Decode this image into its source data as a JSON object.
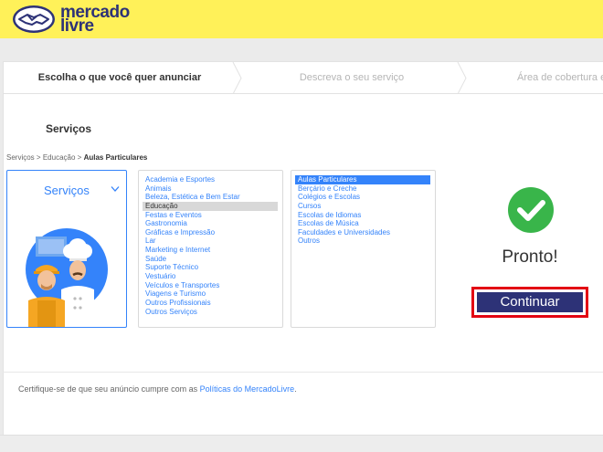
{
  "header": {
    "logo_line1": "mercado",
    "logo_line2": "livre",
    "background": "#fff159"
  },
  "steps": [
    {
      "label": "Escolha o que você quer anunciar",
      "state": "active"
    },
    {
      "label": "Descreva o seu serviço",
      "state": "inactive"
    },
    {
      "label": "Área de cobertura e",
      "state": "inactive"
    }
  ],
  "section_title": "Serviços",
  "breadcrumb": {
    "items": [
      "Serviços",
      "Educação"
    ],
    "separator": ">",
    "current": "Aulas Particulares"
  },
  "category_card": {
    "title": "Serviços",
    "icon": "chevron-down-icon"
  },
  "list1": {
    "items": [
      "Academia e Esportes",
      "Animais",
      "Beleza, Estética e Bem Estar",
      "Educação",
      "Festas e Eventos",
      "Gastronomia",
      "Gráficas e Impressão",
      "Lar",
      "Marketing e Internet",
      "Saúde",
      "Suporte Técnico",
      "Vestuário",
      "Veículos e Transportes",
      "Viagens e Turismo",
      "Outros Profissionais",
      "Outros Serviços"
    ],
    "selected": "Educação"
  },
  "list2": {
    "items": [
      "Aulas Particulares",
      "Berçário e Creche",
      "Colégios e Escolas",
      "Cursos",
      "Escolas de Idiomas",
      "Escolas de Música",
      "Faculdades e Universidades",
      "Outros"
    ],
    "selected": "Aulas Particulares"
  },
  "done": {
    "icon": "check-icon",
    "label": "Pronto!",
    "button": "Continuar",
    "button_color": "#2d3277",
    "highlight_color": "#e30613"
  },
  "footer": {
    "text": "Certifique-se de que seu anúncio cumpre com as",
    "link": "Políticas do MercadoLivre",
    "suffix": "."
  }
}
